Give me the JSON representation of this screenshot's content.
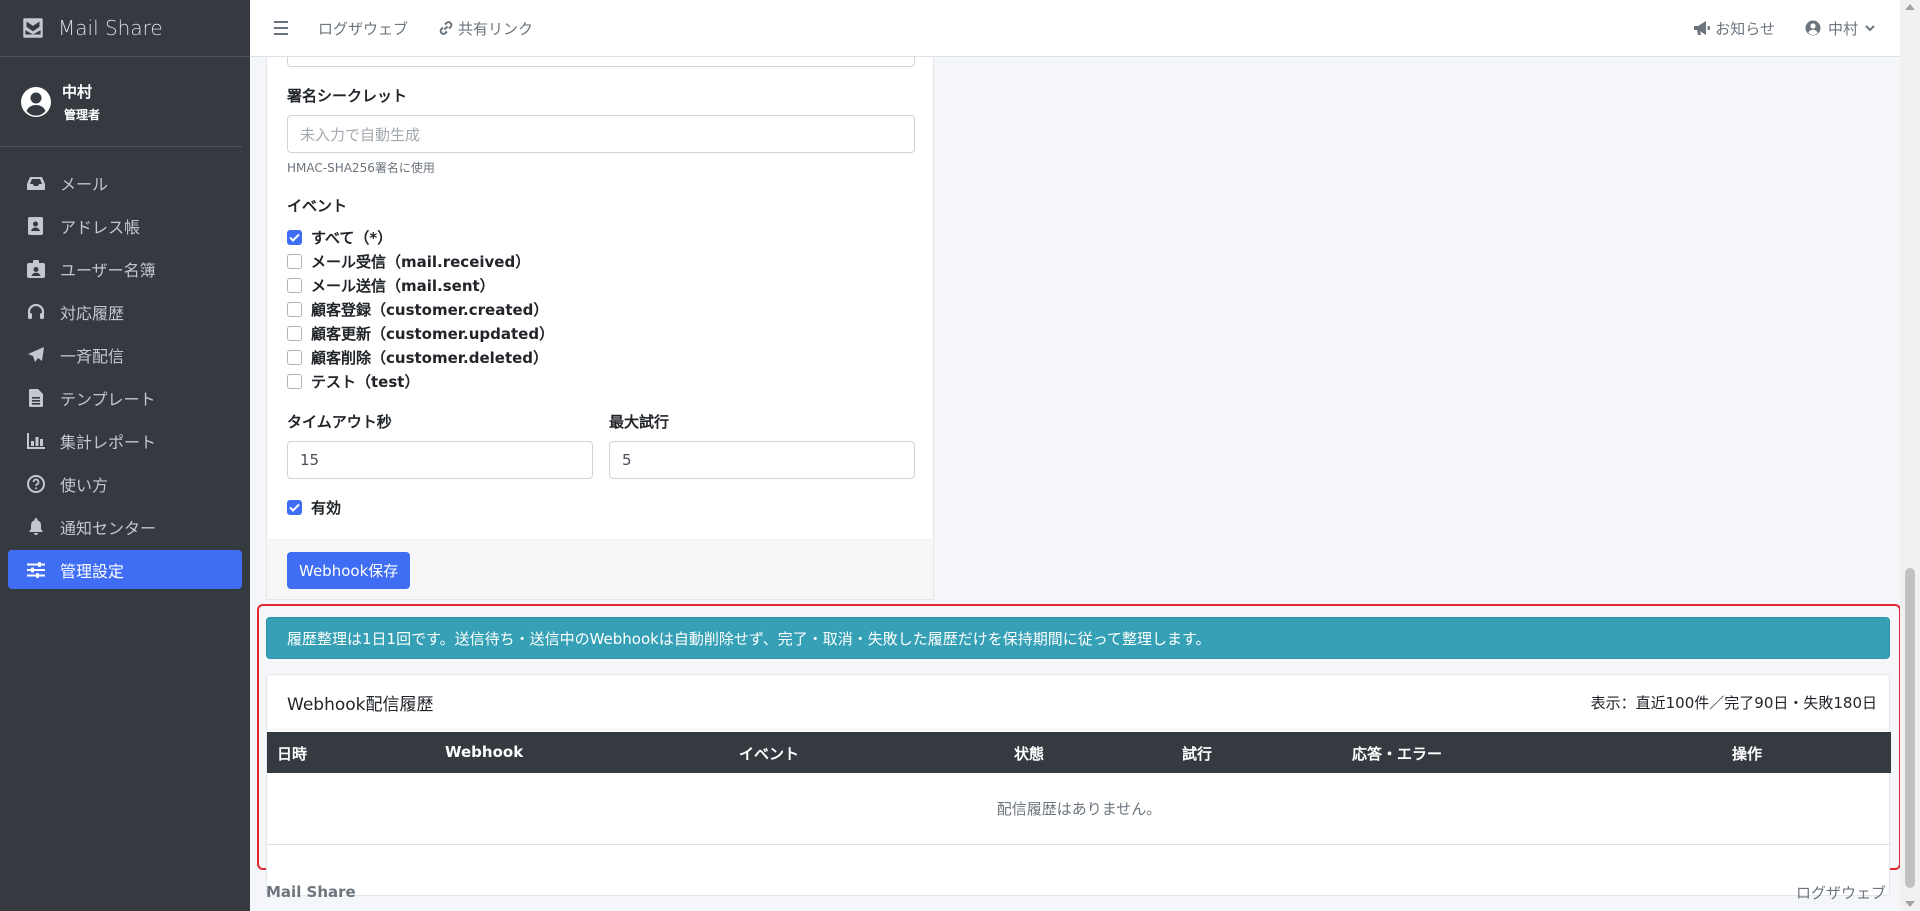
{
  "app": {
    "brand": "Mail Share"
  },
  "user": {
    "name": "中村",
    "role": "管理者"
  },
  "sidebar": {
    "items": [
      {
        "label": "メール",
        "icon": "inbox-icon"
      },
      {
        "label": "アドレス帳",
        "icon": "address-book-icon"
      },
      {
        "label": "ユーザー名簿",
        "icon": "id-badge-icon"
      },
      {
        "label": "対応履歴",
        "icon": "headset-icon"
      },
      {
        "label": "一斉配信",
        "icon": "paper-plane-icon"
      },
      {
        "label": "テンプレート",
        "icon": "file-icon"
      },
      {
        "label": "集計レポート",
        "icon": "chart-icon"
      },
      {
        "label": "使い方",
        "icon": "question-circle-icon"
      },
      {
        "label": "通知センター",
        "icon": "bell-icon"
      },
      {
        "label": "管理設定",
        "icon": "sliders-icon",
        "active": true
      }
    ]
  },
  "topbar": {
    "links": {
      "logout": "ログザウェブ",
      "share": "共有リンク"
    },
    "notice": "お知らせ",
    "user": "中村"
  },
  "form": {
    "secret_label": "署名シークレット",
    "secret_placeholder": "未入力で自動生成",
    "secret_help": "HMAC-SHA256署名に使用",
    "events_label": "イベント",
    "events": [
      {
        "label": "すべて（*）",
        "checked": true
      },
      {
        "label": "メール受信（mail.received）",
        "checked": false
      },
      {
        "label": "メール送信（mail.sent）",
        "checked": false
      },
      {
        "label": "顧客登録（customer.created）",
        "checked": false
      },
      {
        "label": "顧客更新（customer.updated）",
        "checked": false
      },
      {
        "label": "顧客削除（customer.deleted）",
        "checked": false
      },
      {
        "label": "テスト（test）",
        "checked": false
      }
    ],
    "timeout_label": "タイムアウト秒",
    "timeout_value": "15",
    "retry_label": "最大試行",
    "retry_value": "5",
    "enabled_label": "有効",
    "enabled_checked": true,
    "save_label": "Webhook保存"
  },
  "alert": {
    "text": "履歴整理は1日1回です。送信待ち・送信中のWebhookは自動削除せず、完了・取消・失敗した履歴だけを保持期間に従って整理します。"
  },
  "history": {
    "title": "Webhook配信履歴",
    "meta": "表示：直近100件／完了90日・失敗180日",
    "columns": [
      "日時",
      "Webhook",
      "イベント",
      "状態",
      "試行",
      "応答・エラー",
      "操作"
    ],
    "empty": "配信履歴はありません。"
  },
  "footer": {
    "left": "Mail Share",
    "right": "ログザウェブ"
  },
  "colors": {
    "accent": "#3f6ef5",
    "sidebar": "#343a40",
    "info": "#35a0b6",
    "highlight": "#e3262f"
  }
}
